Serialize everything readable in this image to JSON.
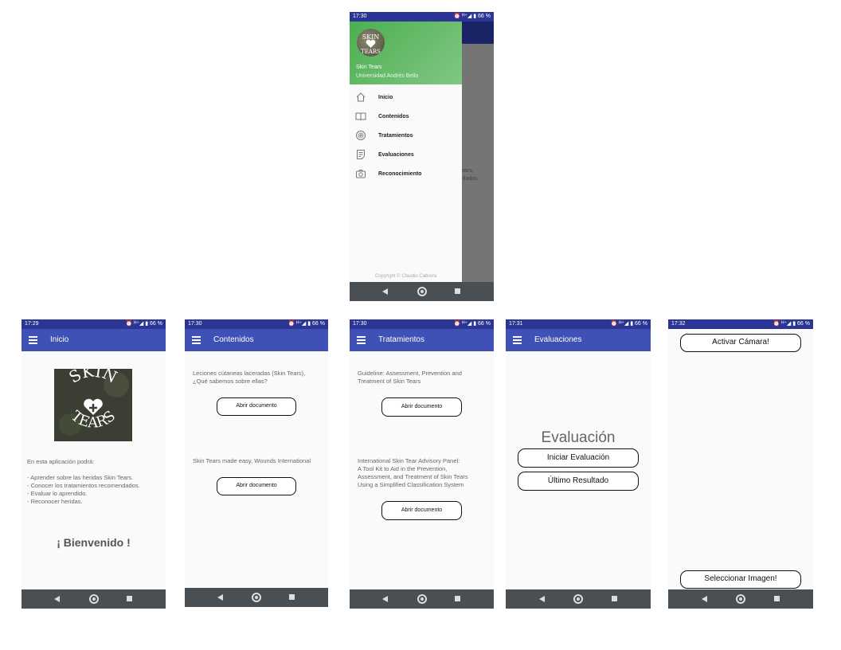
{
  "drawer_screen": {
    "status": {
      "time": "17:30",
      "icons": "⏰ ᴴ⁺◢ ▮ 66 %"
    },
    "header": {
      "title": "Skin Tears",
      "subtitle": "Universidad Andrés Bello"
    },
    "items": [
      {
        "label": "Inicio",
        "icon": "home-icon"
      },
      {
        "label": "Contenidos",
        "icon": "book-icon"
      },
      {
        "label": "Tratamientos",
        "icon": "medical-icon"
      },
      {
        "label": "Evaluaciones",
        "icon": "checklist-icon"
      },
      {
        "label": "Reconocimiento",
        "icon": "camera-icon"
      }
    ],
    "footer": "Copyright © Claudio Cabrera",
    "behind_text": "ears,\nidados."
  },
  "inicio_screen": {
    "status": {
      "time": "17:29",
      "icons": "⏰ ᴴ⁺◢ ▮ 66 %"
    },
    "title": "Inicio",
    "logo_text": {
      "top": "SKIN",
      "bottom": "TEARS"
    },
    "description": "En esta aplicación podrá:\n\n- Aprender sobre las heridas Skin Tears.\n- Conocer los tratamientos recomendados.\n- Evaluar lo aprendido.\n- Reconocer heridas.",
    "welcome": "¡ Bienvenido !"
  },
  "contenidos_screen": {
    "status": {
      "time": "17:30",
      "icons": "⏰ ᴴ⁺◢ ▮ 66 %"
    },
    "title": "Contenidos",
    "doc1": "Leciones cútaneas laceradas (Skin Tears),\n¿Qué sabemos sobre ellas?",
    "doc2": "Skin Tears made easy, Wounds International",
    "open_label": "Abrir documento"
  },
  "tratamientos_screen": {
    "status": {
      "time": "17:30",
      "icons": "⏰ ᴴ⁺◢ ▮ 66 %"
    },
    "title": "Tratamientos",
    "doc1": "Guideline: Assessment, Prevention and\nTreatment of Skin Tears",
    "doc2": "International Skin Tear Advisory Panel:\nA Tool Kit to Aid in the Prevention,\nAssessment, and Treatment of Skin Tears\nUsing a Simplified Classification System",
    "open_label": "Abrir documento"
  },
  "evaluaciones_screen": {
    "status": {
      "time": "17:31",
      "icons": "⏰ ᴴ⁺◢ ▮ 66 %"
    },
    "title": "Evaluaciones",
    "heading": "Evaluación",
    "start_label": "Iniciar Evaluación",
    "last_label": "Último Resultado"
  },
  "reconocimiento_screen": {
    "status": {
      "time": "17:32",
      "icons": "⏰ ᴴ⁺◢ ▮ 66 %"
    },
    "camera_label": "Activar Cámara!",
    "select_label": "Seleccionar Imagen!"
  }
}
